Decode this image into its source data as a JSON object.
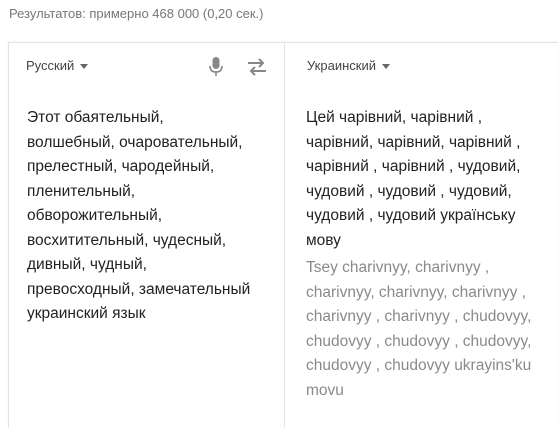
{
  "results_stats": "Результатов: примерно 468 000 (0,20 сек.)",
  "source": {
    "language": "Русский",
    "mic_icon": "microphone-icon",
    "text": "Этот обаятельный,\nволшебный, очаровательный,\nпрелестный, чародейный,\nпленительный,\nобворожительный,\nвосхитительный, чудесный,\nдивный, чудный,\nпревосходный, замечательный\nукраинский язык"
  },
  "swap_icon": "swap-languages-icon",
  "target": {
    "language": "Украинский",
    "text": "Цей чарівний, чарівний ,\nчарівний, чарівний, чарівний ,\nчарівний , чарівний , чудовий,\nчудовий , чудовий , чудовий,\nчудовий , чудовий українську\nмову",
    "transliteration": "Tsey charivnyy, charivnyy ,\ncharivnyy, charivnyy, charivnyy ,\ncharivnyy , charivnyy , chudovyy,\nchudovyy , chudovyy , chudovyy,\nchudovyy , chudovyy ukrayins'ku\nmovu"
  },
  "colors": {
    "text": "#222222",
    "muted": "#777777",
    "transliteration": "#8a8a8a",
    "border": "#e3e3e3"
  }
}
